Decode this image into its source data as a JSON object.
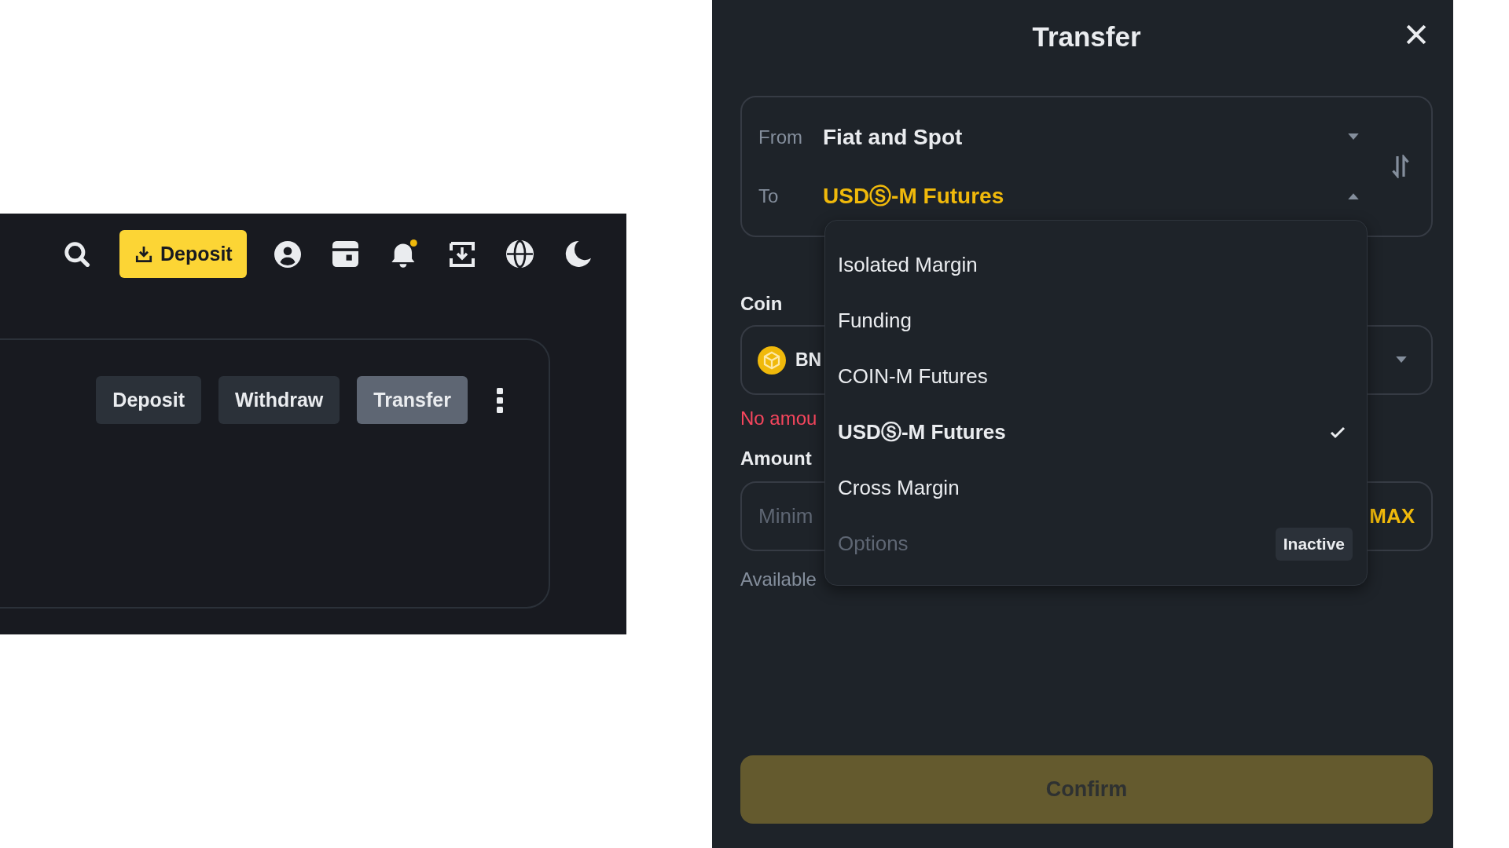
{
  "header": {
    "deposit_button": "Deposit",
    "notification_dot": true
  },
  "account_card": {
    "buttons": [
      {
        "label": "Deposit",
        "selected": false
      },
      {
        "label": "Withdraw",
        "selected": false
      },
      {
        "label": "Transfer",
        "selected": true
      }
    ]
  },
  "transfer_dialog": {
    "title": "Transfer",
    "from": {
      "label": "From",
      "value": "Fiat and Spot",
      "open": false
    },
    "to": {
      "label": "To",
      "value": "USDⓈ-M Futures",
      "open": true,
      "options": [
        {
          "label": "Isolated Margin",
          "selected": false,
          "disabled": false
        },
        {
          "label": "Funding",
          "selected": false,
          "disabled": false
        },
        {
          "label": "COIN-M Futures",
          "selected": false,
          "disabled": false
        },
        {
          "label": "USDⓈ-M Futures",
          "selected": true,
          "disabled": false
        },
        {
          "label": "Cross Margin",
          "selected": false,
          "disabled": false
        },
        {
          "label": "Options",
          "selected": false,
          "disabled": true,
          "badge": "Inactive"
        }
      ]
    },
    "coin": {
      "label": "Coin",
      "value": "BN"
    },
    "error": "No amou",
    "amount": {
      "label": "Amount",
      "placeholder": "Minim",
      "max_button": "MAX"
    },
    "available": "Available",
    "confirm_button": {
      "label": "Confirm",
      "disabled": true
    }
  }
}
